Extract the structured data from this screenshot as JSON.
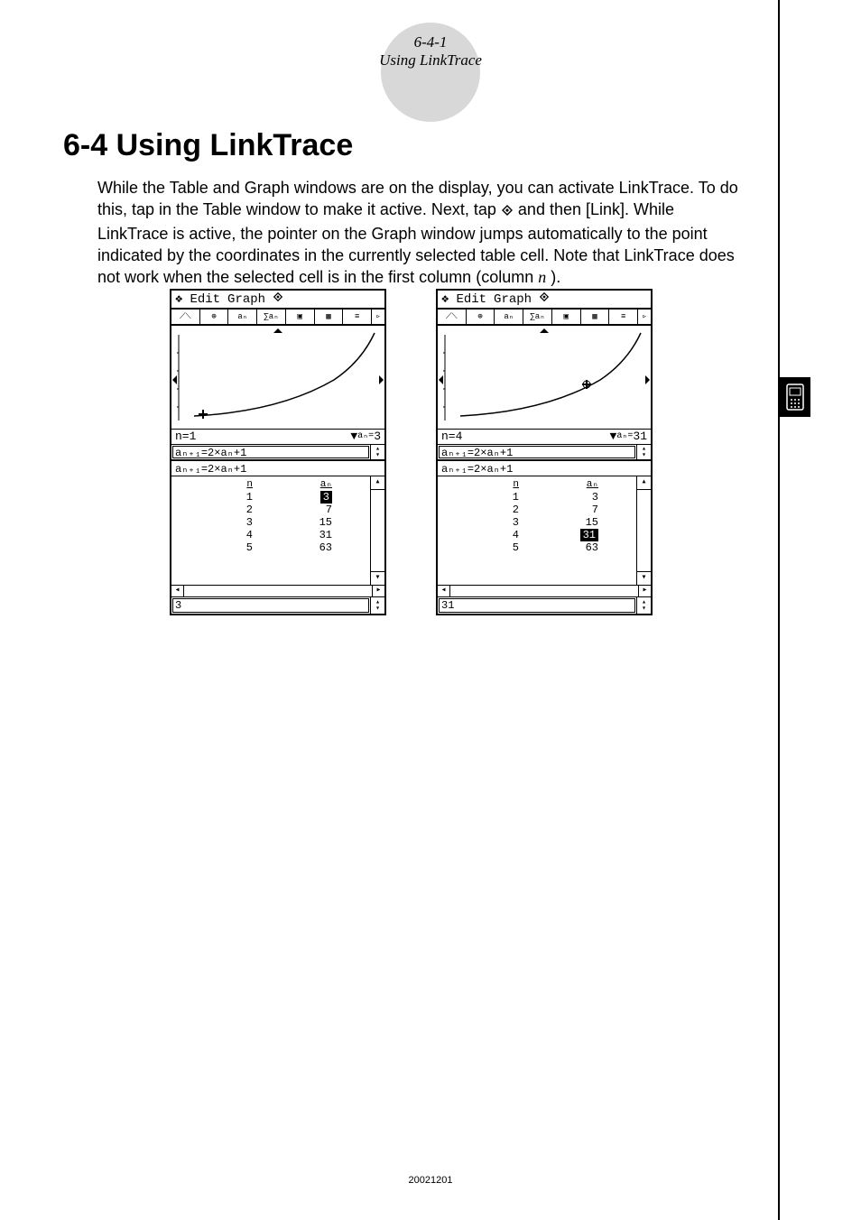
{
  "header": {
    "page_number": "6-4-1",
    "page_title": "Using LinkTrace"
  },
  "section": {
    "heading": "6-4 Using LinkTrace"
  },
  "body": {
    "p1_a": "While the Table and Graph windows are on the display, you can activate LinkTrace. To do this, tap in the Table window to make it active. Next, tap ",
    "p1_b": " and then [Link]. While LinkTrace is active, the pointer on the Graph window jumps automatically to the point indicated by the coordinates in the currently selected table cell. Note that LinkTrace does not work when the selected cell is in the first column (column ",
    "p1_var": "n",
    "p1_c": ")."
  },
  "screens": [
    {
      "menu": {
        "edit": "Edit",
        "graph": "Graph"
      },
      "coord": {
        "n_label": "n=",
        "n_val": "1",
        "a_label": "aₙ=",
        "a_val": "3"
      },
      "formula_top": "aₙ₊₁=2×aₙ+1",
      "formula_table": "aₙ₊₁=2×aₙ+1",
      "table": {
        "col1_header": "n",
        "col2_header": "aₙ",
        "rows": [
          {
            "n": "1",
            "an": "3",
            "highlight": "an"
          },
          {
            "n": "2",
            "an": "7"
          },
          {
            "n": "3",
            "an": "15"
          },
          {
            "n": "4",
            "an": "31"
          },
          {
            "n": "5",
            "an": "63"
          }
        ]
      },
      "bottom_value": "3",
      "trace_point_index": 0
    },
    {
      "menu": {
        "edit": "Edit",
        "graph": "Graph"
      },
      "coord": {
        "n_label": "n=",
        "n_val": "4",
        "a_label": "aₙ=",
        "a_val": "31"
      },
      "formula_top": "aₙ₊₁=2×aₙ+1",
      "formula_table": "aₙ₊₁=2×aₙ+1",
      "table": {
        "col1_header": "n",
        "col2_header": "aₙ",
        "rows": [
          {
            "n": "1",
            "an": "3"
          },
          {
            "n": "2",
            "an": "7"
          },
          {
            "n": "3",
            "an": "15"
          },
          {
            "n": "4",
            "an": "31",
            "highlight": "an"
          },
          {
            "n": "5",
            "an": "63"
          }
        ]
      },
      "bottom_value": "31",
      "trace_point_index": 3
    }
  ],
  "chart_data": {
    "type": "line",
    "x": [
      1,
      2,
      3,
      4,
      5
    ],
    "y": [
      3,
      7,
      15,
      31,
      63
    ],
    "title": "",
    "xlabel": "n",
    "ylabel": "aₙ",
    "xlim": [
      0,
      6
    ],
    "ylim": [
      0,
      70
    ]
  },
  "footer": {
    "doc_id": "20021201"
  }
}
